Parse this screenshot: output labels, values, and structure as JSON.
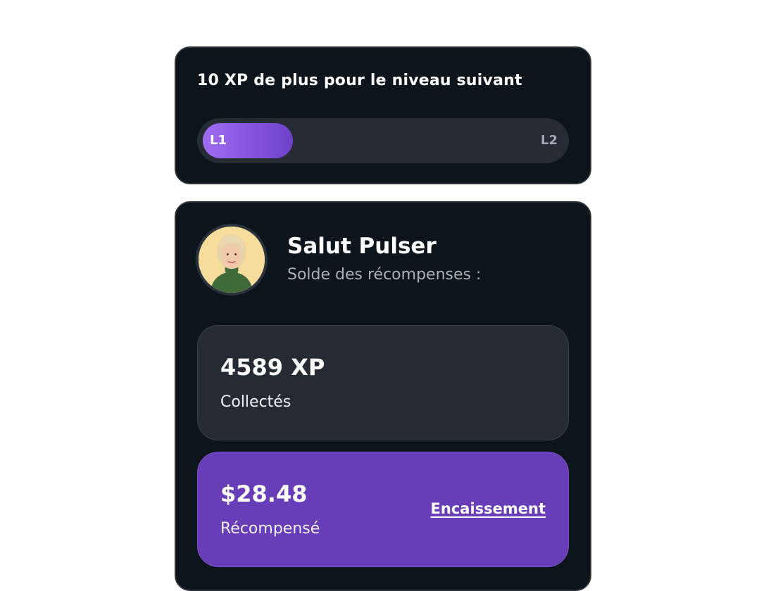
{
  "level": {
    "title": "10 XP de plus pour le niveau suivant",
    "start_label": "L1",
    "end_label": "L2",
    "progress_fraction": 0.25,
    "fill_colors": [
      "#a06cf2",
      "#7041c8"
    ]
  },
  "profile": {
    "greeting": "Salut Pulser",
    "balance_label": "Solde des récompenses :",
    "avatar_icon": "user-avatar-photo"
  },
  "xp": {
    "value": "4589 XP",
    "caption": "Collectés"
  },
  "reward": {
    "value": "$28.48",
    "caption": "Récompensé",
    "action_label": "Encaissement",
    "accent_color": "#6a3db8"
  }
}
